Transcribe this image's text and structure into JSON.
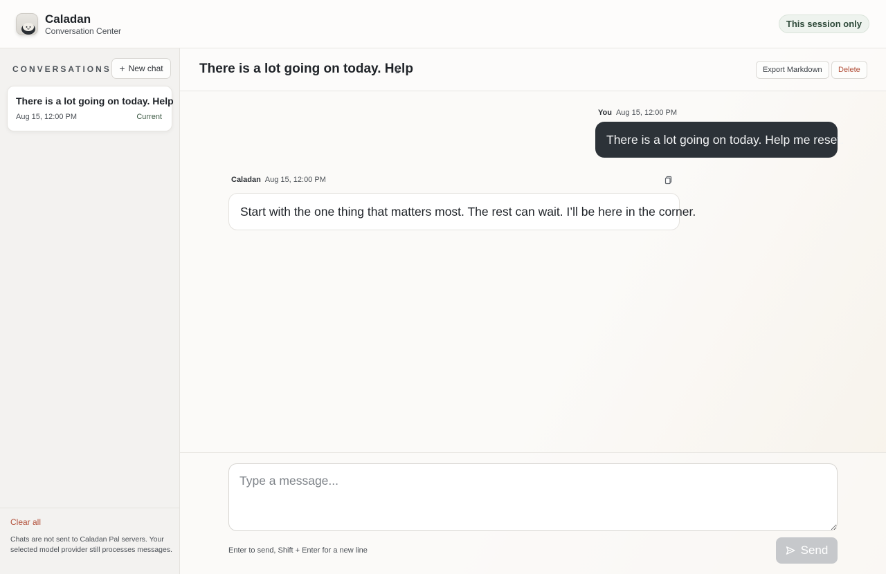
{
  "header": {
    "brand_name": "Caladan",
    "brand_sub": "Conversation Center",
    "session_pill": "This session only"
  },
  "sidebar": {
    "heading": "CONVERSATIONS",
    "new_chat_label": "New chat",
    "conversations": [
      {
        "title": "There is a lot going on today. Help",
        "time": "Aug 15, 12:00 PM",
        "badge": "Current"
      }
    ],
    "clear_all_label": "Clear all",
    "privacy_note": "Chats are not sent to Caladan Pal servers. Your selected model provider still processes messages."
  },
  "chat": {
    "title": "There is a lot going on today. Help",
    "message_count": "2",
    "export_label": "Export Markdown",
    "delete_label": "Delete",
    "messages": [
      {
        "author": "You",
        "time": "Aug 15, 12:00 PM",
        "text": "There is a lot going on today. Help me reset."
      },
      {
        "author": "Caladan",
        "time": "Aug 15, 12:00 PM",
        "text": "Start with the one thing that matters most. The rest can wait. I’ll be here in the corner."
      }
    ]
  },
  "composer": {
    "value": "",
    "placeholder": "Type a message...",
    "hint": "Enter to send, Shift + Enter for a new line",
    "send_label": "Send"
  },
  "icons": {
    "logo": "caladan-mascot-icon",
    "new_chat": "plus-icon",
    "copy": "copy-icon",
    "send": "send-icon"
  },
  "colors": {
    "user_bubble": "#2c3238",
    "danger": "#b2503a",
    "session_pill_bg": "#eef3ee",
    "send_disabled": "#c6c8cb"
  }
}
